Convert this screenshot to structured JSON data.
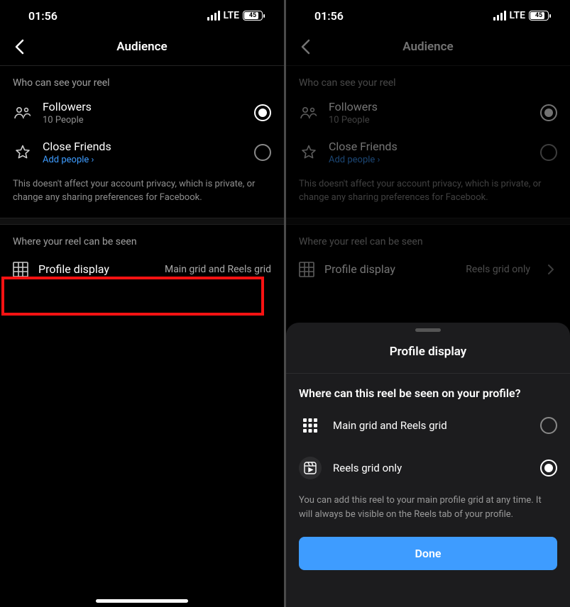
{
  "status": {
    "time": "01:56",
    "network": "LTE",
    "battery": "45"
  },
  "header": {
    "title": "Audience"
  },
  "sections": {
    "who_heading": "Who can see your reel",
    "followers": {
      "title": "Followers",
      "sub": "10 People"
    },
    "close_friends": {
      "title": "Close Friends",
      "sub": "Add people ›"
    },
    "privacy_note": "This doesn't affect your account privacy, which is private, or change any sharing preferences for Facebook.",
    "where_heading": "Where your reel can be seen",
    "profile_display_label": "Profile display",
    "profile_display_value_left": "Main grid and Reels grid",
    "profile_display_value_right": "Reels grid only"
  },
  "sheet": {
    "title": "Profile display",
    "question": "Where can this reel be seen on your profile?",
    "option1": "Main grid and Reels grid",
    "option2": "Reels grid only",
    "info": "You can add this reel to your main profile grid at any time. It will always be visible on the Reels tab of your profile.",
    "done": "Done"
  }
}
